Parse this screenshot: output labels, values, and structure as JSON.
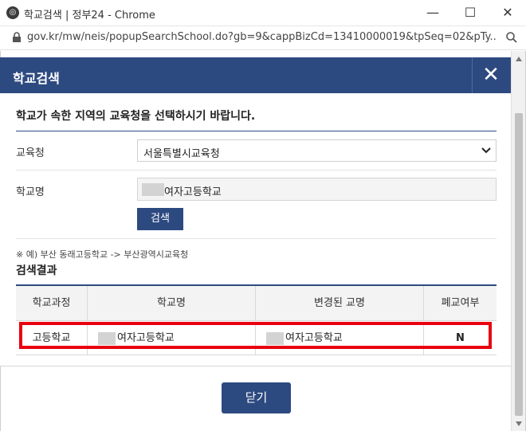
{
  "window": {
    "title": "학교검색 | 정부24 - Chrome",
    "minimize": "—",
    "maximize": "☐",
    "close": "✕"
  },
  "addressbar": {
    "url": "gov.kr/mw/neis/popupSearchSchool.do?gb=9&cappBizCd=13410000019&tpSeq=02&pTy..."
  },
  "popup": {
    "title": "학교검색",
    "close_icon": "✕",
    "instruction": "학교가 속한 지역의 교육청을 선택하시기 바랍니다.",
    "form": {
      "office_label": "교육청",
      "office_value": "서울특별시교육청",
      "school_label": "학교명",
      "school_value": "여자고등학교",
      "search_button": "검색"
    },
    "example": "※ 예) 부산 동래고등학교 -> 부산광역시교육청",
    "results_title": "검색결과",
    "table": {
      "headers": [
        "학교과정",
        "학교명",
        "변경된 교명",
        "폐교여부"
      ],
      "rows": [
        [
          "고등학교",
          "여자고등학교",
          "여자고등학교",
          "N"
        ]
      ]
    },
    "close_button": "닫기"
  },
  "colors": {
    "header_navy": "#2d4a80",
    "highlight_red": "#e8000f"
  },
  "icons": {
    "app": "globe-icon",
    "lock": "lock-icon",
    "zoom": "magnifier-icon"
  }
}
